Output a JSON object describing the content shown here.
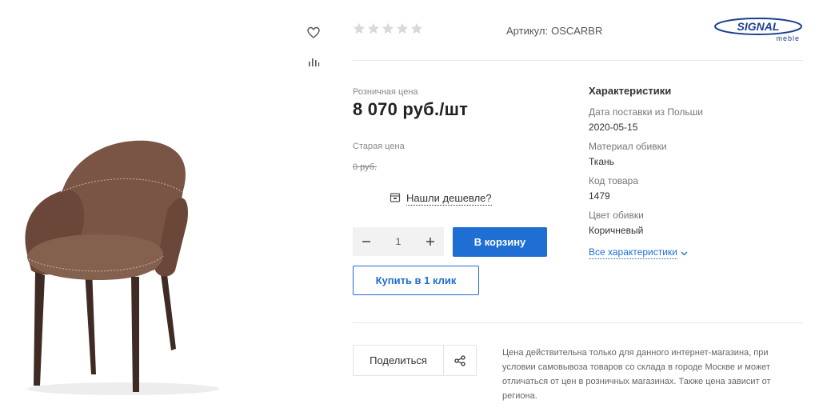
{
  "product": {
    "article_label": "Артикул:",
    "article_value": "OSCARBR",
    "rating": 0,
    "rating_max": 5
  },
  "brand": {
    "name": "SIGNAL",
    "sub": "meble",
    "color": "#1b3f8f"
  },
  "price": {
    "retail_label": "Розничная цена",
    "retail_value": "8 070 руб./шт",
    "old_label": "Старая цена",
    "old_value": "0 руб."
  },
  "cheaper": {
    "label": "Нашли дешевле?"
  },
  "cart": {
    "quantity": "1",
    "add_label": "В корзину",
    "one_click_label": "Купить в 1 клик"
  },
  "specs": {
    "title": "Характеристики",
    "items": [
      {
        "label": "Дата поставки из Польши",
        "value": "2020-05-15"
      },
      {
        "label": "Материал обивки",
        "value": "Ткань"
      },
      {
        "label": "Код товара",
        "value": "1479"
      },
      {
        "label": "Цвет обивки",
        "value": "Коричневый"
      }
    ],
    "all_label": "Все характеристики"
  },
  "share": {
    "label": "Поделиться"
  },
  "disclaimer": "Цена действительна только для данного интернет-магазина, при условии самовывоза товаров со склада в городе Москве и может отличаться от цен в розничных магазинах. Также цена зависит от региона.",
  "colors": {
    "accent": "#1f6ed4",
    "chair": "#7a5445",
    "star": "#d9d9d9"
  },
  "icons": {
    "favorite": "heart-icon",
    "compare": "bar-chart-icon",
    "cheaper": "price-tag-icon",
    "share": "share-icon",
    "all_specs": "chevron-down-icon"
  }
}
